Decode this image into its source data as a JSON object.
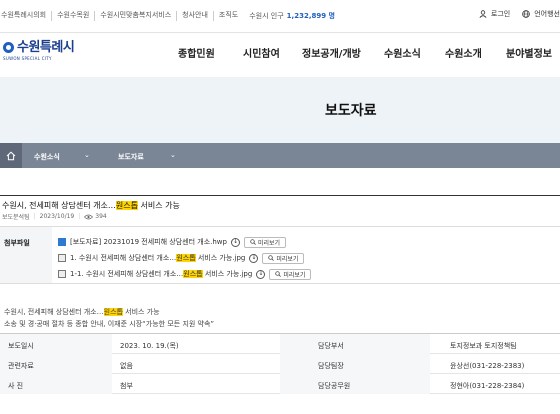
{
  "utilbar": {
    "links": [
      "수원특례시의회",
      "수원수목원",
      "수원시민맞춤복지서비스",
      "청사안내",
      "조직도"
    ],
    "population_label": "수원시 인구",
    "population_value": "1,232,899 명",
    "login": "로그인",
    "language": "언어행선"
  },
  "header": {
    "logo_name": "수원특례시",
    "logo_sub": "SUWON SPECIAL CITY",
    "gnb": [
      "종합민원",
      "시민참여",
      "정보공개/개방",
      "수원소식",
      "수원소개",
      "분야별정보"
    ]
  },
  "banner": {
    "title": "보도자료"
  },
  "breadcrumb": {
    "level1": "수원소식",
    "level2": "보도자료"
  },
  "article": {
    "title_pre": "수원시, 전세피해 상담센터 개소…",
    "title_hl": "원스톱",
    "title_post": " 서비스 가능",
    "dept": "보도분석팀",
    "date": "2023/10/19",
    "views": "394",
    "attach_label": "첨부파일",
    "files": [
      {
        "type": "hwp",
        "pre": "[보도자료] 20231019 전세피해 상담센터 개소.hwp",
        "hl": "",
        "post": "",
        "preview": "미리보기"
      },
      {
        "type": "img",
        "pre": "1. 수원시 전세피해 상담센터 개소…",
        "hl": "원스톱",
        "post": " 서비스 가능.jpg",
        "preview": "미리보기"
      },
      {
        "type": "img",
        "pre": "1-1. 수원시 전세피해 상담센터 개소…",
        "hl": "원스톱",
        "post": " 서비스 가능.jpg",
        "preview": "미리보기"
      }
    ],
    "summary_line1_pre": "수원시, 전세피해 상담센터 개소…",
    "summary_line1_hl": "원스톱",
    "summary_line1_post": " 서비스 가능",
    "summary_line2": "소송 및 경·공매 절차 등 종합 안내, 이재준 시장“가능한 모든 지원 약속”"
  },
  "info": {
    "rows": [
      {
        "k1": "보도일시",
        "v1": "2023. 10. 19.(목)",
        "k2": "담당부서",
        "v2": "토지정보과 토지정책팀"
      },
      {
        "k1": "관련자료",
        "v1": "없음",
        "k2": "담당팀장",
        "v2": "윤상선(031-228-2383)"
      },
      {
        "k1": "사 진",
        "v1": "첨부",
        "k2": "담당공무원",
        "v2": "정현아(031-228-2384)"
      }
    ]
  },
  "colors": {
    "accent": "#1f5fbf",
    "highlight": "#ffd400",
    "breadcrumb": "#7a8595",
    "banner": "#eef3f8"
  }
}
